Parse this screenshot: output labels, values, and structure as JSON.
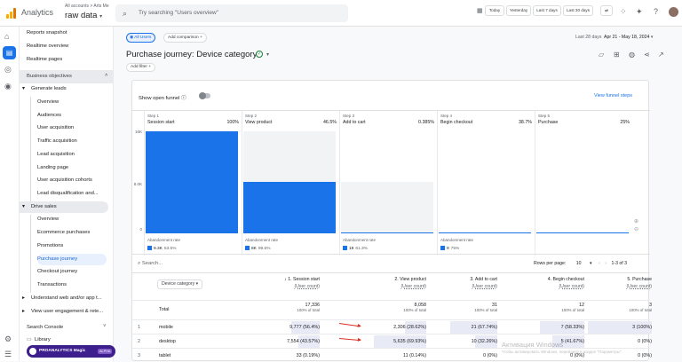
{
  "app": {
    "name": "Analytics",
    "account_path": "All accounts > Arts Me",
    "property": "raw data"
  },
  "search": {
    "placeholder": "Try searching \"Users overview\""
  },
  "date_buttons": [
    "Today",
    "Yesterday",
    "Last 7 days",
    "Last 30 days"
  ],
  "sidebar": {
    "top_items": [
      "Reports snapshot",
      "Realtime overview",
      "Realtime pages"
    ],
    "section": "Business objectives",
    "groups": [
      {
        "label": "Generate leads",
        "items": [
          "Overview",
          "Audiences",
          "User acquisition",
          "Traffic acquisition",
          "Lead acquisition",
          "Landing page",
          "User acquisition cohorts",
          "Lead disqualification and..."
        ]
      },
      {
        "label": "Drive sales",
        "items": [
          "Overview",
          "Ecommerce purchases",
          "Promotions",
          "Purchase journey",
          "Checkout journey",
          "Transactions"
        ],
        "active": "Purchase journey"
      },
      {
        "label": "Understand web and/or app t..."
      },
      {
        "label": "View user engagement & rete..."
      }
    ],
    "search_console": "Search Console",
    "library": "Library"
  },
  "banner": {
    "label": "PROANALYTICS Magic",
    "tag": "ALPHA"
  },
  "toolbar": {
    "all_users": "All Users",
    "add_comparison": "Add comparison",
    "range_label": "Last 28 days",
    "range_dates": "Apr 21 - May 18, 2024"
  },
  "page": {
    "title": "Purchase journey: Device category",
    "add_filter": "Add filter"
  },
  "funnel": {
    "show_open_funnel": "Show open funnel",
    "view_steps": "View funnel steps",
    "y_ticks": [
      "16K",
      "8.0K",
      "0"
    ],
    "steps": [
      {
        "num": "Step 1",
        "label": "Session start",
        "pct": "100%",
        "abandon_label": "Abandonment rate",
        "abandon": "9.3K",
        "abandon_pct": "53.5%"
      },
      {
        "num": "Step 2",
        "label": "View product",
        "pct": "46.5%",
        "abandon_label": "Abandonment rate",
        "abandon": "8K",
        "abandon_pct": "99.6%"
      },
      {
        "num": "Step 3",
        "label": "Add to cart",
        "pct": "0.385%",
        "abandon_label": "Abandonment rate",
        "abandon": "19",
        "abandon_pct": "61.3%"
      },
      {
        "num": "Step 4",
        "label": "Begin checkout",
        "pct": "38.7%",
        "abandon_label": "Abandonment rate",
        "abandon": "9",
        "abandon_pct": "75%"
      },
      {
        "num": "Step 5",
        "label": "Purchase",
        "pct": "25%"
      }
    ]
  },
  "chart_data": {
    "type": "bar",
    "categories": [
      "Session start",
      "View product",
      "Add to cart",
      "Begin checkout",
      "Purchase"
    ],
    "values": [
      17336,
      8058,
      31,
      12,
      3
    ],
    "ylim": [
      0,
      16000
    ]
  },
  "table": {
    "search_placeholder": "Search...",
    "rows_per_page_label": "Rows per page:",
    "rows_per_page": "10",
    "pagination": "1-3 of 3",
    "dimension": "Device category",
    "columns": [
      {
        "title": "↓ 1. Session start",
        "sub": "(User count)"
      },
      {
        "title": "2. View product",
        "sub": "(User count)"
      },
      {
        "title": "3. Add to cart",
        "sub": "(User count)"
      },
      {
        "title": "4. Begin checkout",
        "sub": "(User count)"
      },
      {
        "title": "5. Purchase",
        "sub": "(User count)"
      }
    ],
    "total_label": "Total",
    "totals": [
      "17,336",
      "8,058",
      "31",
      "12",
      "3"
    ],
    "totals_sub": [
      "100% of total",
      "100% of total",
      "100% of total",
      "100% of total",
      "100% of total"
    ],
    "rows": [
      {
        "idx": "1",
        "name": "mobile",
        "cells": [
          "9,777 (56.4%)",
          "2,306 (28.62%)",
          "21 (67.74%)",
          "7 (58.33%)",
          "3 (100%)"
        ]
      },
      {
        "idx": "2",
        "name": "desktop",
        "cells": [
          "7,554 (43.57%)",
          "5,635 (69.93%)",
          "10 (32.26%)",
          "5 (41.67%)",
          "0 (0%)"
        ]
      },
      {
        "idx": "3",
        "name": "tablet",
        "cells": [
          "33 (0.19%)",
          "11 (0.14%)",
          "0 (0%)",
          "0 (0%)",
          "0 (0%)"
        ]
      }
    ]
  },
  "watermark": {
    "title": "Активация Windows",
    "sub": "Чтобы активировать Windows, перейдите в раздел \"Параметры\"."
  },
  "colors": {
    "accent": "#1a73e8",
    "bar": "#1a73e8",
    "sidebar_active": "#e8f0fe",
    "banner": "#3c1e8c"
  }
}
